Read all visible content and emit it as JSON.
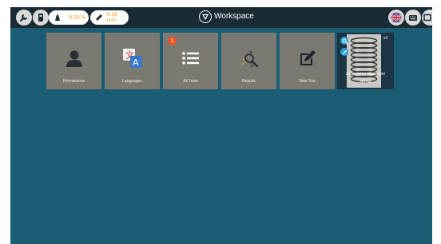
{
  "header": {
    "title": "Workspace",
    "force_value": "0.00 N",
    "distance_value": "0.00 mm"
  },
  "tiles": [
    {
      "label": "Permissions",
      "icon": "user-icon"
    },
    {
      "label": "Languages",
      "icon": "translate-icon"
    },
    {
      "label": "All Tests",
      "icon": "list-icon",
      "badge": "1"
    },
    {
      "label": "Results",
      "icon": "results-icon"
    },
    {
      "label": "New Test",
      "icon": "edit-icon"
    }
  ],
  "product": {
    "label_line1": "2 cm pump dispenser",
    "label_line2": "spring",
    "counter": "v3"
  },
  "colors": {
    "background": "#1b5d74",
    "topbar": "#1a2b36",
    "tile": "#7a7a73",
    "accent": "#f5a623",
    "badge": "#e8572a",
    "product_action": "#2e9fd8"
  }
}
